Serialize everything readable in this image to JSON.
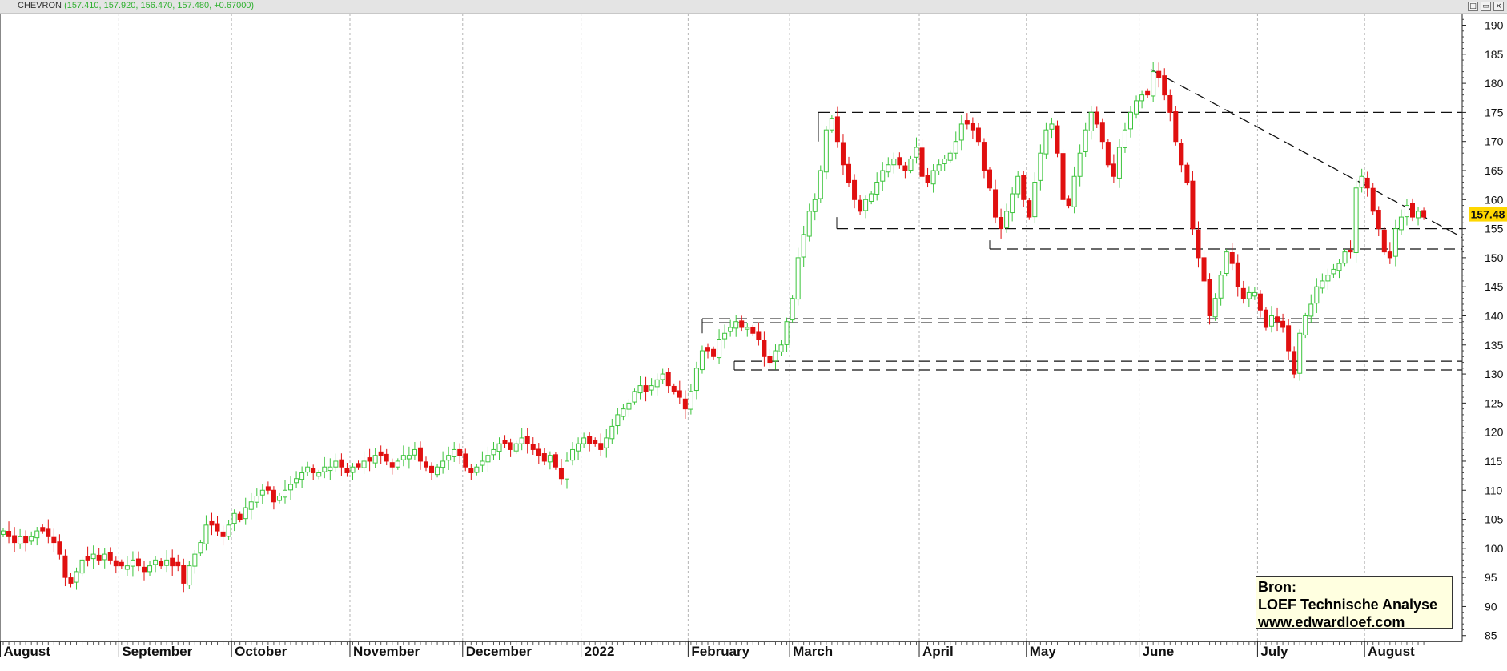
{
  "window": {
    "symbol": "CHEVRON",
    "quote": "(157.410, 157.920, 156.470, 157.480, +0.67000)",
    "buttons": [
      "□",
      "▭",
      "×"
    ]
  },
  "source_box": {
    "line1": "Bron:",
    "line2": "LOEF Technische Analyse",
    "line3": "www.edwardloef.com"
  },
  "colors": {
    "up": "#3cc43c",
    "down": "#e01010",
    "grid": "#b4b4b4",
    "lines": "#111111",
    "price_badge": "#ffd700"
  },
  "chart_data": {
    "type": "candlestick",
    "ylim": [
      84,
      192
    ],
    "yticks": [
      85,
      90,
      95,
      100,
      105,
      110,
      115,
      120,
      125,
      130,
      135,
      140,
      145,
      150,
      155,
      160,
      165,
      170,
      175,
      180,
      185,
      190
    ],
    "months": [
      {
        "label": "August",
        "start": 0
      },
      {
        "label": "September",
        "start": 21
      },
      {
        "label": "October",
        "start": 41
      },
      {
        "label": "November",
        "start": 62
      },
      {
        "label": "December",
        "start": 82
      },
      {
        "label": "2022",
        "start": 103
      },
      {
        "label": "February",
        "start": 122
      },
      {
        "label": "March",
        "start": 140
      },
      {
        "label": "April",
        "start": 163
      },
      {
        "label": "May",
        "start": 182
      },
      {
        "label": "June",
        "start": 202
      },
      {
        "label": "July",
        "start": 223
      },
      {
        "label": "August",
        "start": 242
      }
    ],
    "last_price": "157.48",
    "closes": [
      103,
      102,
      101,
      102,
      101,
      102,
      103,
      103,
      102,
      101,
      99,
      95,
      94,
      96,
      98,
      98,
      99,
      98,
      99,
      98,
      97,
      97,
      97,
      98,
      97,
      96,
      97,
      98,
      97,
      98,
      97,
      97,
      94,
      97,
      99,
      101,
      104,
      104,
      103,
      102,
      104,
      106,
      105,
      107,
      108,
      109,
      110,
      110,
      108,
      109,
      110,
      111,
      112,
      113,
      114,
      113,
      113,
      114,
      114,
      115,
      114,
      113,
      114,
      114,
      115,
      115,
      116,
      116,
      115,
      114,
      115,
      116,
      116,
      117,
      115,
      114,
      113,
      114,
      115,
      116,
      117,
      116,
      114,
      113,
      114,
      115,
      116,
      117,
      118,
      118,
      117,
      118,
      119,
      118,
      117,
      116,
      115,
      116,
      114,
      112,
      115,
      117,
      118,
      119,
      118,
      118,
      117,
      119,
      121,
      123,
      124,
      125,
      127,
      128,
      127,
      128,
      129,
      130,
      128,
      127,
      126,
      124,
      127,
      131,
      134,
      134,
      133,
      136,
      137,
      138,
      139,
      138,
      138,
      137,
      136,
      133,
      132,
      134,
      135,
      139,
      143,
      150,
      154,
      158,
      160,
      165,
      172,
      174,
      170,
      166,
      163,
      160,
      158,
      160,
      161,
      163,
      165,
      166,
      167,
      166,
      165,
      167,
      169,
      164,
      163,
      165,
      166,
      167,
      168,
      170,
      173,
      173,
      172,
      170,
      165,
      162,
      157,
      155,
      158,
      161,
      164,
      160,
      157,
      163,
      168,
      172,
      173,
      168,
      160,
      159,
      164,
      168,
      172,
      175,
      173,
      170,
      166,
      164,
      169,
      172,
      175,
      177,
      178,
      178,
      182,
      181,
      178,
      175,
      170,
      166,
      163,
      155,
      150,
      146,
      140,
      143,
      147,
      151,
      149,
      145,
      143,
      144,
      144,
      141,
      138,
      140,
      139,
      138,
      134,
      130,
      137,
      140,
      142,
      145,
      146,
      147,
      148,
      149,
      151,
      151,
      162,
      164,
      162,
      158,
      155,
      151,
      150,
      155,
      157,
      159,
      157,
      158,
      157
    ]
  }
}
